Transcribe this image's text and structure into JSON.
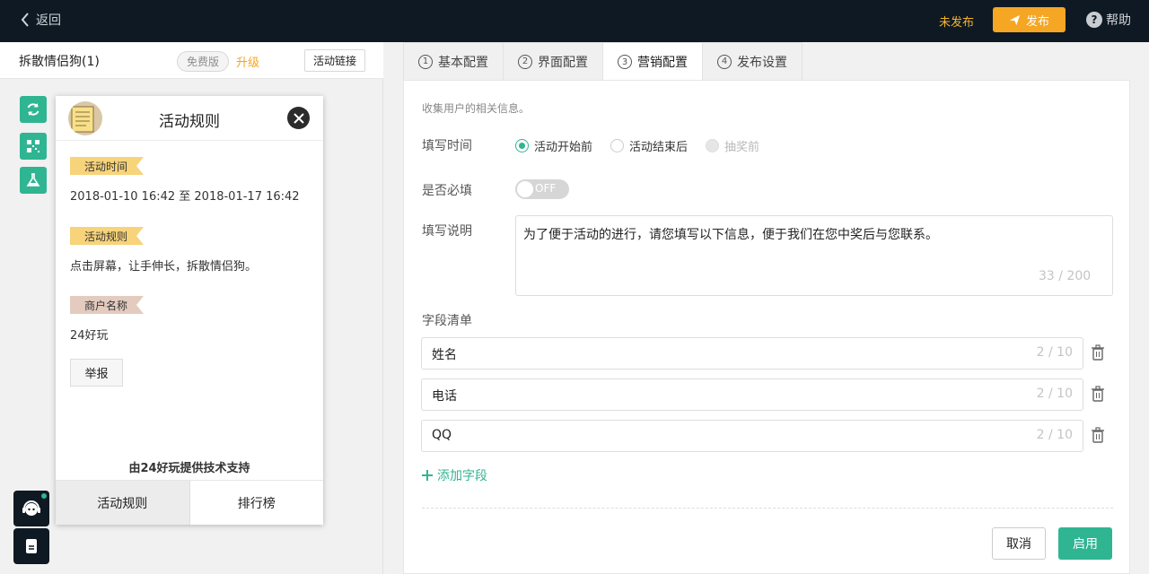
{
  "topbar": {
    "back_label": "返回",
    "status": "未发布",
    "publish_label": "发布",
    "help_label": "帮助",
    "help_symbol": "?"
  },
  "left": {
    "title": "拆散情侣狗(1)",
    "free_badge": "免费版",
    "upgrade": "升级",
    "link_button": "活动链接",
    "tools": [
      "refresh-icon",
      "qrcode-icon",
      "flask-icon"
    ]
  },
  "card": {
    "title": "活动规则",
    "sections": [
      {
        "tag": "活动时间",
        "text": "2018-01-10 16:42 至 2018-01-17 16:42"
      },
      {
        "tag": "活动规则",
        "text": "点击屏幕，让手伸长，拆散情侣狗。"
      },
      {
        "tag": "商户名称",
        "text": "24好玩"
      }
    ],
    "report_label": "举报",
    "support_text": "由24好玩提供技术支持",
    "tabs": [
      "活动规则",
      "排行榜"
    ]
  },
  "tabs": [
    {
      "num": "1",
      "label": "基本配置"
    },
    {
      "num": "2",
      "label": "界面配置"
    },
    {
      "num": "3",
      "label": "营销配置",
      "active": true
    },
    {
      "num": "4",
      "label": "发布设置"
    }
  ],
  "form": {
    "description": "收集用户的相关信息。",
    "time_label": "填写时间",
    "time_options": [
      "活动开始前",
      "活动结束后",
      "抽奖前"
    ],
    "time_selected": "活动开始前",
    "required_label": "是否必填",
    "required_toggle": "OFF",
    "note_label": "填写说明",
    "note_value": "为了便于活动的进行，请您填写以下信息，便于我们在您中奖后与您联系。",
    "note_counter": "33 / 200",
    "fields_label": "字段清单",
    "fields": [
      {
        "value": "姓名",
        "counter": "2 / 10"
      },
      {
        "value": "电话",
        "counter": "2 / 10"
      },
      {
        "value": "QQ",
        "counter": "2 / 10"
      }
    ],
    "add_field": "添加字段",
    "cancel": "取消",
    "enable": "启用"
  },
  "colors": {
    "accent": "#2fb592",
    "publish": "#f5a623",
    "topbar": "#0f1923"
  }
}
